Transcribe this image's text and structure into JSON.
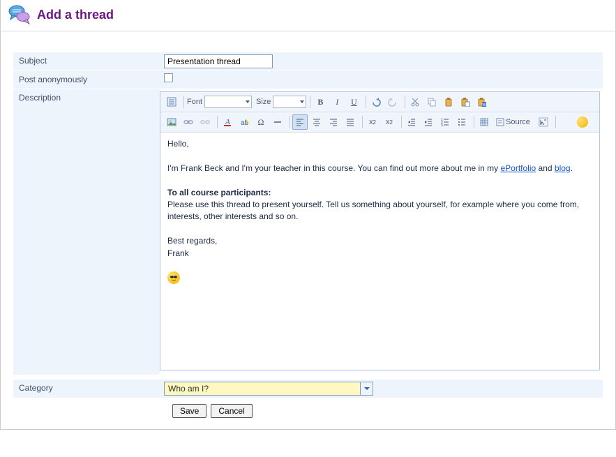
{
  "header": {
    "title": "Add a thread"
  },
  "labels": {
    "subject": "Subject",
    "anonymously": "Post anonymously",
    "description": "Description",
    "category": "Category"
  },
  "subject": {
    "value": "Presentation thread"
  },
  "anonymous": {
    "checked": false
  },
  "editor": {
    "font_label": "Font",
    "size_label": "Size",
    "font_value": "",
    "size_value": "",
    "source_label": "Source",
    "body": {
      "greeting": "Hello,",
      "intro_pre": "I'm Frank Beck and I'm your teacher in this course. You can find out more about me in my ",
      "link_eportfolio": "ePortfolio",
      "intro_mid": " and ",
      "link_blog": "blog",
      "intro_end": ".",
      "bold_line": "To all course participants:",
      "para2": "Please use this thread to present yourself. Tell us something about yourself, for example where you come from, interests, other interests and so on.",
      "regards1": "Best regards,",
      "regards2": "Frank"
    }
  },
  "category": {
    "value": "Who am I?"
  },
  "buttons": {
    "save": "Save",
    "cancel": "Cancel"
  }
}
